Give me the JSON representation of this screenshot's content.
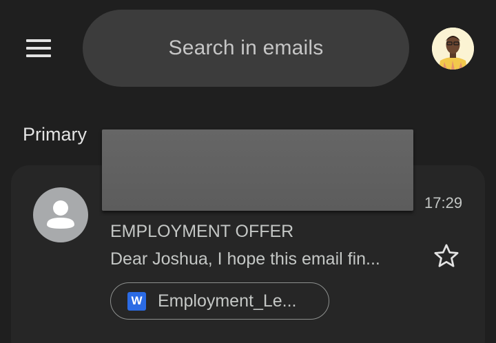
{
  "header": {
    "search_placeholder": "Search in emails",
    "menu_icon": "hamburger-menu-icon",
    "account_avatar": "profile-photo"
  },
  "inbox": {
    "section_label": "Primary"
  },
  "email": {
    "time": "17:29",
    "subject": "EMPLOYMENT OFFER",
    "snippet": "Dear Joshua, I hope this email fin...",
    "sender_avatar_icon": "person-icon",
    "star_icon": "star-outline-icon",
    "starred": false,
    "attachment": {
      "icon": "word-doc-icon",
      "icon_letter": "W",
      "name": "Employment_Le..."
    }
  },
  "colors": {
    "background": "#1f1f1f",
    "search_bar": "#3c3c3c",
    "card": "#262626",
    "text_primary": "#e3e3e3",
    "text_secondary": "#c4c7c5",
    "word_blue": "#2b6be4",
    "redaction": "#616161"
  }
}
